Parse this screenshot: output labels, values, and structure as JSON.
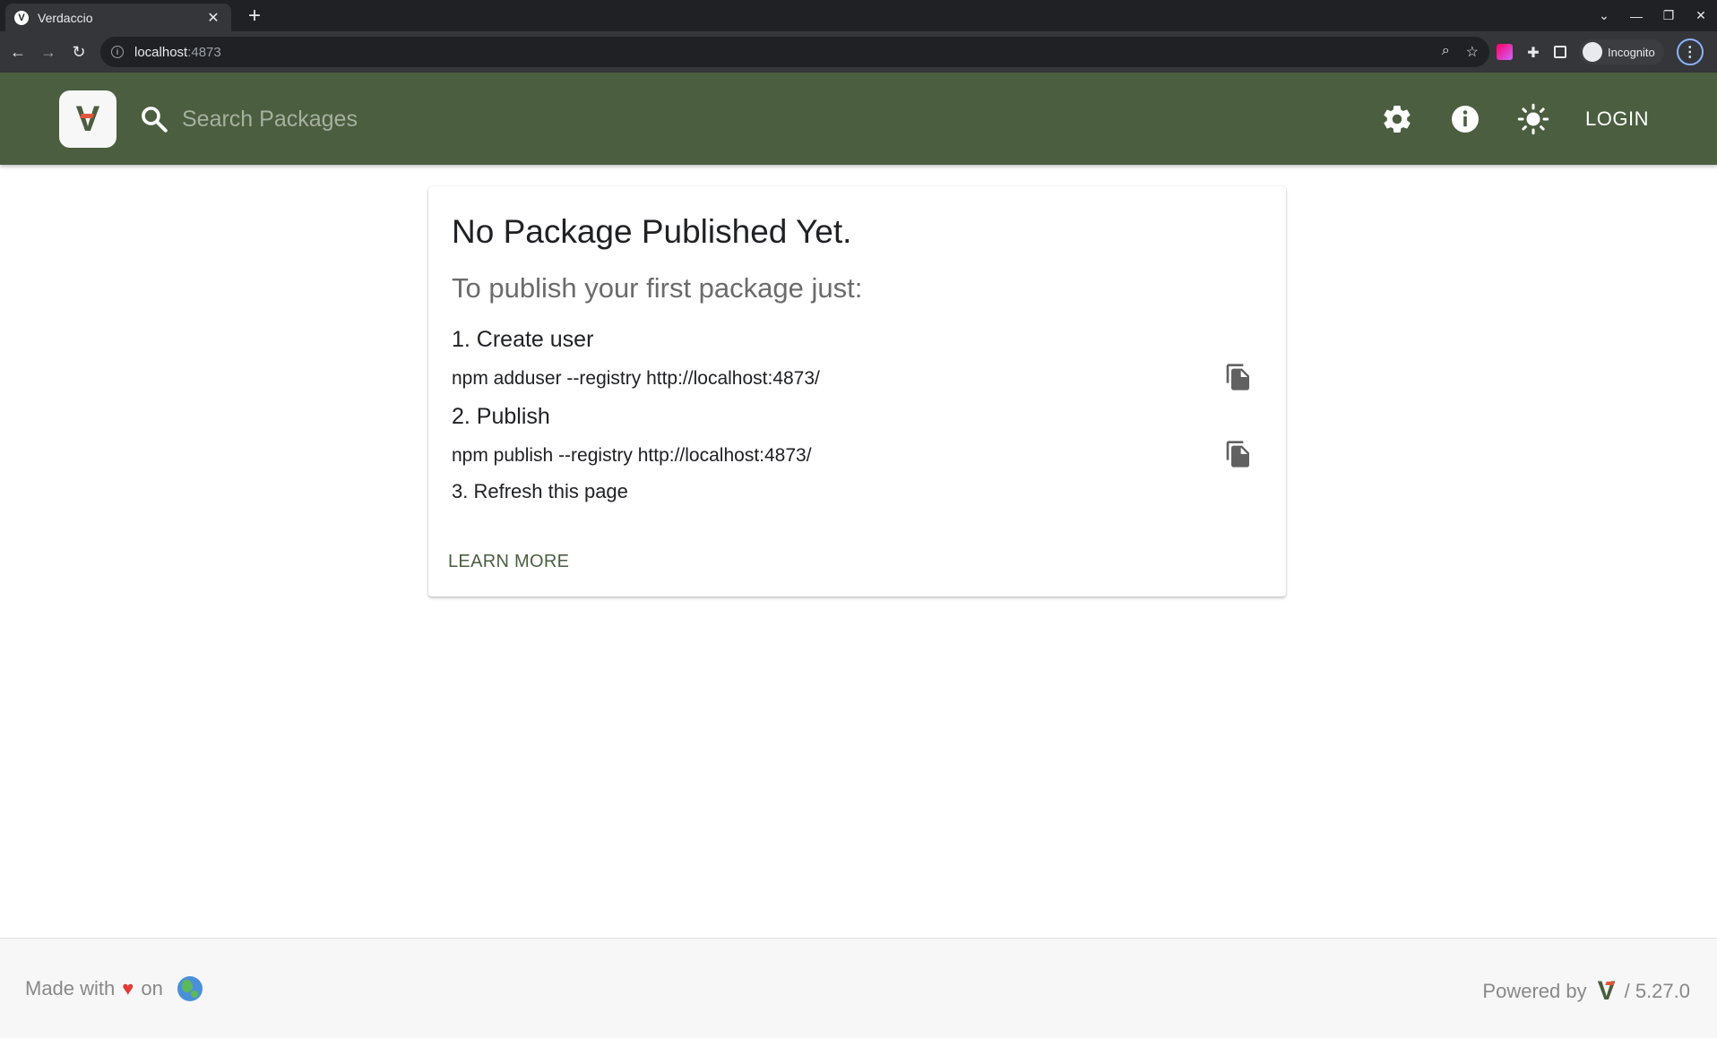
{
  "browser": {
    "tab_title": "Verdaccio",
    "tab_favicon_letter": "V",
    "url_host": "localhost",
    "url_port": ":4873",
    "incognito_label": "Incognito"
  },
  "header": {
    "search_placeholder": "Search Packages",
    "login_label": "LOGIN",
    "background_color": "#4b5e40"
  },
  "card": {
    "title": "No Package Published Yet.",
    "subtitle": "To publish your first package just:",
    "steps": [
      {
        "label": "1. Create user",
        "command": "npm adduser --registry http://localhost:4873/"
      },
      {
        "label": "2. Publish",
        "command": "npm publish --registry http://localhost:4873/"
      },
      {
        "label": "3. Refresh this page"
      }
    ],
    "learn_more": "LEARN MORE"
  },
  "footer": {
    "made_with": "Made with",
    "heart": "♥",
    "on": "on",
    "powered_by": "Powered by",
    "version": "/ 5.27.0"
  }
}
